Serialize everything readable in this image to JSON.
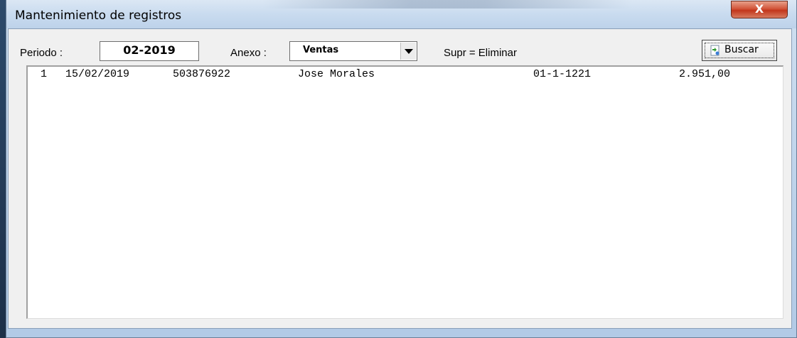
{
  "window": {
    "title": "Mantenimiento de registros",
    "close_label": "X"
  },
  "toolbar": {
    "periodo_label": "Periodo :",
    "periodo_value": "02-2019",
    "anexo_label": "Anexo :",
    "anexo_value": "Ventas",
    "hint": "Supr = Eliminar",
    "buscar_label": "Buscar"
  },
  "records": [
    {
      "num": "1",
      "fecha": "15/02/2019",
      "id": "503876922",
      "nombre": "Jose Morales",
      "codigo": "01-1-1221",
      "monto": "2.951,00"
    }
  ],
  "icons": {
    "buscar": "search-icon",
    "dropdown": "chevron-down-icon",
    "close": "close-icon"
  }
}
